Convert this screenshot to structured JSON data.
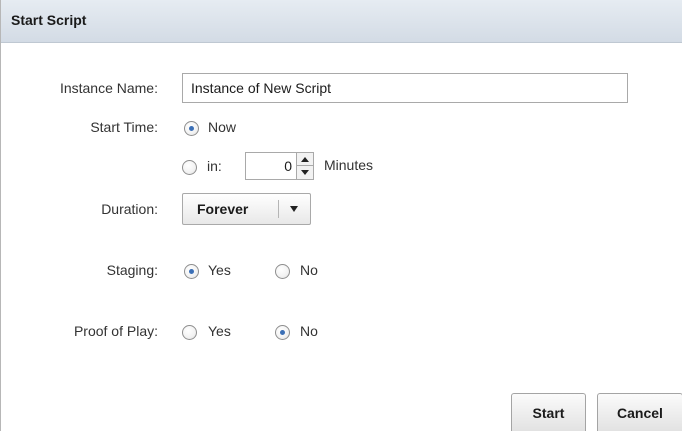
{
  "dialog": {
    "title": "Start Script"
  },
  "form": {
    "instance_name": {
      "label": "Instance Name:",
      "value": "Instance of New Script"
    },
    "start_time": {
      "label": "Start Time:",
      "now_label": "Now",
      "in_label": "in:",
      "selected": "now",
      "minutes_value": "0",
      "minutes_unit": "Minutes"
    },
    "duration": {
      "label": "Duration:",
      "selected": "Forever"
    },
    "staging": {
      "label": "Staging:",
      "yes_label": "Yes",
      "no_label": "No",
      "selected": "yes"
    },
    "proof_of_play": {
      "label": "Proof of Play:",
      "yes_label": "Yes",
      "no_label": "No",
      "selected": "no"
    }
  },
  "buttons": {
    "start_label": "Start",
    "cancel_label": "Cancel"
  },
  "colors": {
    "titlebar": "#d9e1ea",
    "radio_dot": "#3b6fb6"
  }
}
